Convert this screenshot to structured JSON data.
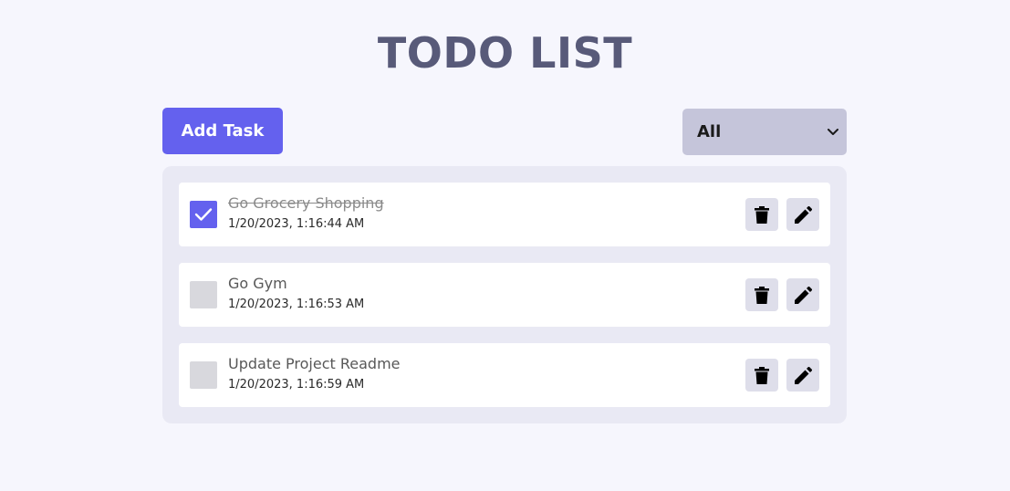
{
  "header": {
    "title": "TODO LIST"
  },
  "toolbar": {
    "add_label": "Add Task",
    "filter_value": "All"
  },
  "colors": {
    "accent": "#6461ee",
    "background": "#f6f6fd",
    "panel": "#e9e9f4",
    "select": "#c5c5da",
    "title": "#585a79"
  },
  "todos": [
    {
      "title": "Go Grocery Shopping",
      "time": "1/20/2023, 1:16:44 AM",
      "completed": true,
      "delete_icon": "trash-icon",
      "edit_icon": "pencil-icon"
    },
    {
      "title": "Go Gym",
      "time": "1/20/2023, 1:16:53 AM",
      "completed": false,
      "delete_icon": "trash-icon",
      "edit_icon": "pencil-icon"
    },
    {
      "title": "Update Project Readme",
      "time": "1/20/2023, 1:16:59 AM",
      "completed": false,
      "delete_icon": "trash-icon",
      "edit_icon": "pencil-icon"
    }
  ]
}
